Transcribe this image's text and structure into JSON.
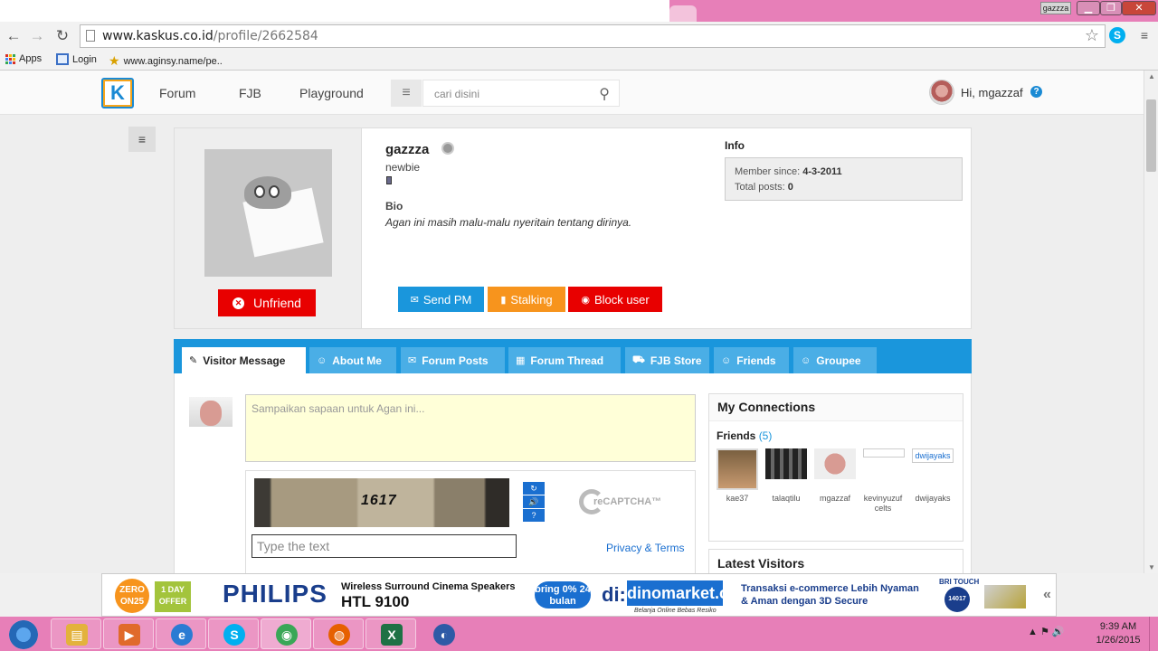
{
  "browser": {
    "url_host": "www.kaskus.co.id",
    "url_path": "/profile/2662584",
    "user_badge": "gazzza",
    "window_controls": {
      "minimize": "▁",
      "maximize": "❐",
      "close": "✕"
    },
    "nav_icons": {
      "back": "←",
      "forward": "→",
      "reload": "↻",
      "star": "☆",
      "menu": "≡"
    },
    "skype_ext_icon": "S",
    "bookmarks": [
      {
        "label": "Apps"
      },
      {
        "label": "Login"
      },
      {
        "label": "www.aginsy.name/pe.."
      }
    ]
  },
  "site": {
    "logo_text": "K",
    "nav": {
      "forum": "Forum",
      "fjb": "FJB",
      "playground": "Playground"
    },
    "search_placeholder": "cari disini",
    "greeting": "Hi, mgazzaf",
    "help_icon": "?",
    "menu_icon": "≡",
    "search_icon": "⚲"
  },
  "profile": {
    "username": "gazzza",
    "rank": "newbie",
    "bio_label": "Bio",
    "bio_text": "Agan ini masih malu-malu nyeritain tentang dirinya.",
    "unfriend_label": "Unfriend",
    "actions": {
      "send_pm": "Send PM",
      "stalking": "Stalking",
      "block_user": "Block user"
    },
    "info_label": "Info",
    "member_since_label": "Member since:",
    "member_since_value": "4-3-2011",
    "total_posts_label": "Total posts:",
    "total_posts_value": "0"
  },
  "tabs": [
    {
      "label": "Visitor Message",
      "icon": "✎",
      "active": true
    },
    {
      "label": "About Me",
      "icon": "☺",
      "active": false
    },
    {
      "label": "Forum Posts",
      "icon": "✉",
      "active": false
    },
    {
      "label": "Forum Thread",
      "icon": "▦",
      "active": false
    },
    {
      "label": "FJB Store",
      "icon": "⛟",
      "active": false
    },
    {
      "label": "Friends",
      "icon": "☺",
      "active": false
    },
    {
      "label": "Groupee",
      "icon": "☺",
      "active": false
    }
  ],
  "visitor_message": {
    "placeholder": "Sampaikan sapaan untuk Agan ini...",
    "captcha_code": "1617",
    "captcha_input_placeholder": "Type the text",
    "privacy_terms": "Privacy & Terms",
    "recaptcha_label": "reCAPTCHA™",
    "captcha_buttons": [
      "↻",
      "🔊",
      "?"
    ]
  },
  "connections": {
    "title": "My Connections",
    "friends_label": "Friends",
    "friends_count": "(5)",
    "friends": [
      {
        "name": "kae37"
      },
      {
        "name": "talaqtilu"
      },
      {
        "name": "mgazzaf"
      },
      {
        "name": "kevinyuzufcelts"
      },
      {
        "name": "dwijayaks",
        "img_alt": "dwijayaks"
      }
    ],
    "latest_visitors_title": "Latest Visitors"
  },
  "ad": {
    "zero": "ZERO ON25",
    "one_day": "1 DAY OFFER",
    "brand": "PHILIPS",
    "product_line": "Wireless Surround Cinema Speakers",
    "product_model": "HTL 9100",
    "bring": "bring 0% 24 bulan",
    "di": "di:",
    "store": "dinomarket.com",
    "store_tag": "Belanja Online Bebas Resiko",
    "transaction_line1": "Transaksi e-commerce Lebih Nyaman",
    "transaction_line2": "& Aman dengan 3D Secure",
    "bank": "BRI TOUCH",
    "bank_phone": "14017",
    "chevron": "«"
  },
  "taskbar": {
    "time": "9:39 AM",
    "date": "1/26/2015",
    "tray_icons": "▲  ⚑  🔊",
    "apps": [
      {
        "name": "explorer",
        "glyph": "▤",
        "color": "#e3b23c"
      },
      {
        "name": "media",
        "glyph": "▶",
        "color": "#e06a2b"
      },
      {
        "name": "ie",
        "glyph": "e",
        "color": "#2a7bd3"
      },
      {
        "name": "skype",
        "glyph": "S",
        "color": "#00aff0"
      },
      {
        "name": "chrome",
        "glyph": "◉",
        "color": "#3aa757"
      },
      {
        "name": "firefox",
        "glyph": "◍",
        "color": "#e66000"
      },
      {
        "name": "excel",
        "glyph": "X",
        "color": "#1e7145"
      },
      {
        "name": "other",
        "glyph": "◐",
        "color": "#2e5aa6"
      }
    ]
  },
  "colors": {
    "accent_blue": "#1a96dc",
    "danger_red": "#e80000",
    "stalking_orange": "#f7941d",
    "taskbar_pink": "#e77fb8"
  }
}
